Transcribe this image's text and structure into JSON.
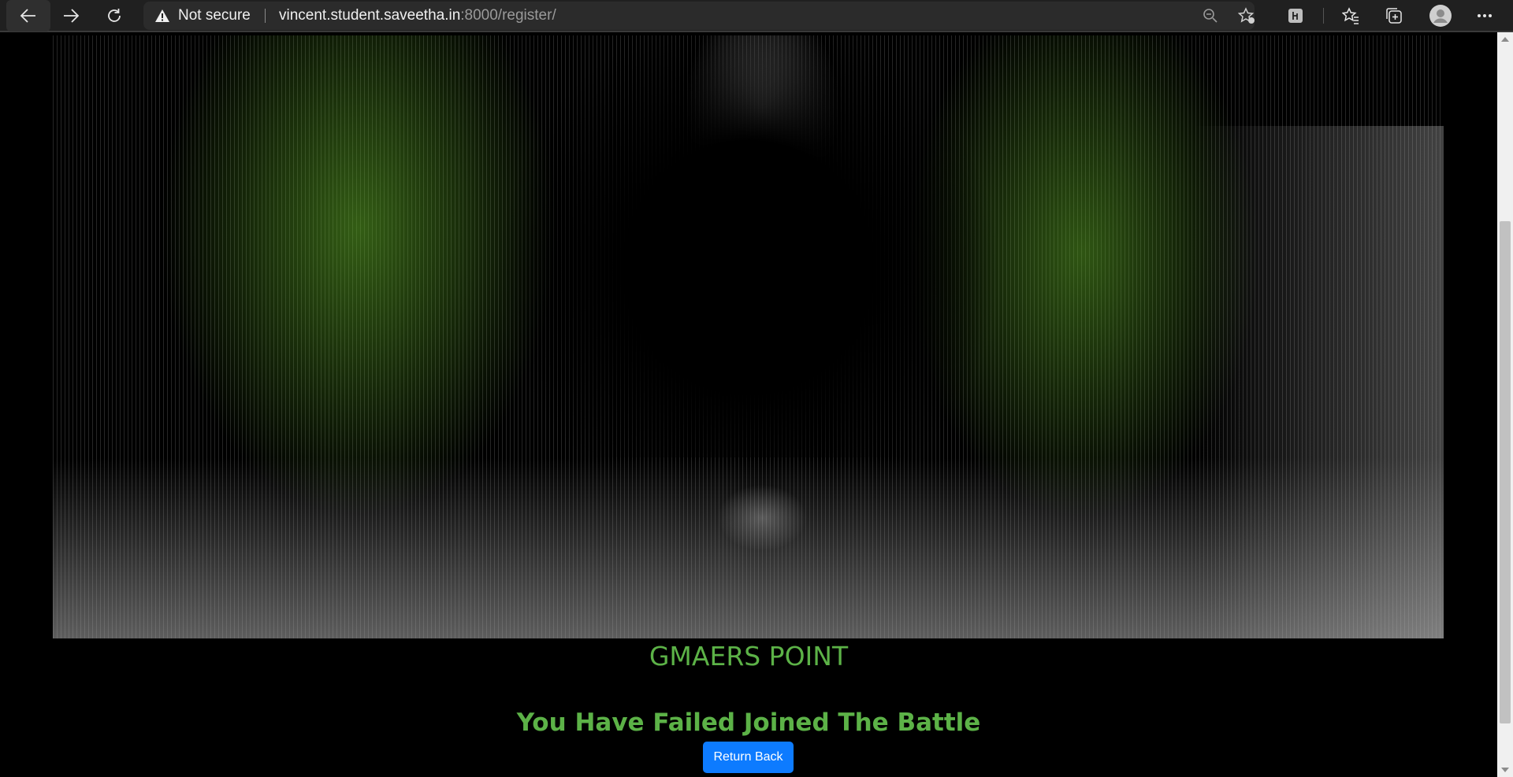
{
  "browser": {
    "security_label": "Not secure",
    "url_host": "vincent.student.saveetha.in",
    "url_rest": ":8000/register/",
    "icons": [
      "back-icon",
      "forward-icon",
      "refresh-icon",
      "warning-icon",
      "zoom-out-icon",
      "add-favorite-icon",
      "extension-icon",
      "favorites-icon",
      "collections-icon",
      "profile-icon",
      "more-icon"
    ]
  },
  "page": {
    "brand_title": "GMAERS POINT",
    "message": "You Have Failed Joined The Battle",
    "return_button": "Return Back"
  },
  "colors": {
    "title_green": "#5cb247",
    "button_blue": "#0d7bff",
    "background": "#000000"
  }
}
